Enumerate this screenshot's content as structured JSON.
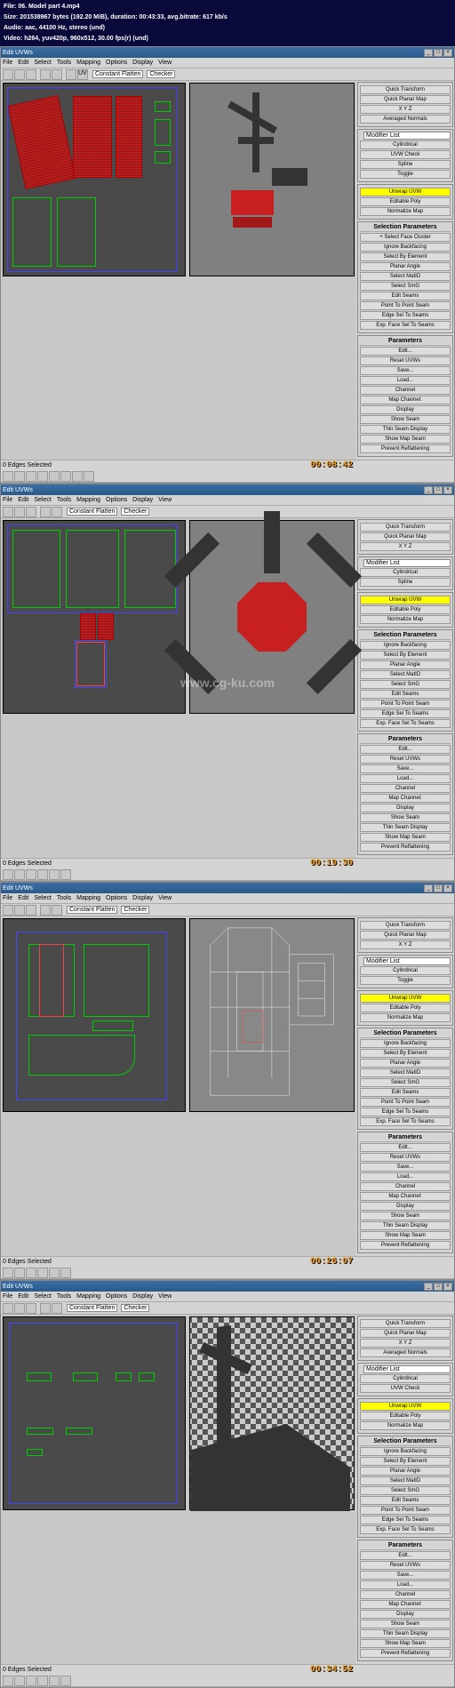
{
  "info": {
    "file": "File: 06. Model part 4.mp4",
    "size": "Size: 201538967 bytes (192.20 MiB), duration: 00:43:33, avg.bitrate: 617 kb/s",
    "audio": "Audio: aac, 44100 Hz, stereo (und)",
    "video": "Video: h264, yuv420p, 960x512, 30.00 fps(r) (und)"
  },
  "watermark": "www.cg-ku.com",
  "uvw": {
    "title": "Edit UVWs",
    "menu": [
      "File",
      "Edit",
      "Select",
      "Tools",
      "Mapping",
      "Options",
      "Display",
      "View"
    ],
    "flatten_dropdown": "Constant Flatten",
    "checker_dropdown": "Checker",
    "status": "0 Edges Selected"
  },
  "panel": {
    "quick_transform": "Quick Transform",
    "modifier_list": "Modifier List",
    "edit_seams": "Edit Seams",
    "selection_params": "Selection Parameters",
    "parameters": "Parameters",
    "unwrap_uvw": "Unwrap UVW",
    "editable_poly": "Editable Poly",
    "btns": {
      "uvw_check": "UVW Check",
      "cylindrical": "Cylindrical",
      "quick_planar_map": "Quick Planar Map",
      "normalize_map": "Normalize Map",
      "edit": "Edit...",
      "reset": "Reset UVWs",
      "save": "Save...",
      "load": "Load...",
      "channel": "Channel",
      "map_channel": "Map Channel:",
      "display": "Display",
      "show_seam": "Show Seam",
      "thin_display": "Thin Seam Display",
      "show_map": "Show Map Seam",
      "prevent": "Prevent Reflattening",
      "point_to_point": "Point To Point Seam",
      "edge_sel_seams": "Edge Sel To Seams",
      "exp_face_sel": "Exp. Face Sel To Seams",
      "ignore_backfacing": "Ignore Backfacing",
      "select_by_element": "Select By Element",
      "planar_angle": "Planar Angle",
      "select_smg": "Select SmG",
      "select_matid": "Select MatID",
      "toggle": "Toggle",
      "averaged": "Averaged Normals",
      "spline": "Spline",
      "xyz": "X  Y  Z",
      "face_cluster": "+ Select Face Cluster"
    }
  },
  "timers": [
    "00:08:42",
    "00:19:30",
    "00:26:07",
    "00:34:52"
  ]
}
